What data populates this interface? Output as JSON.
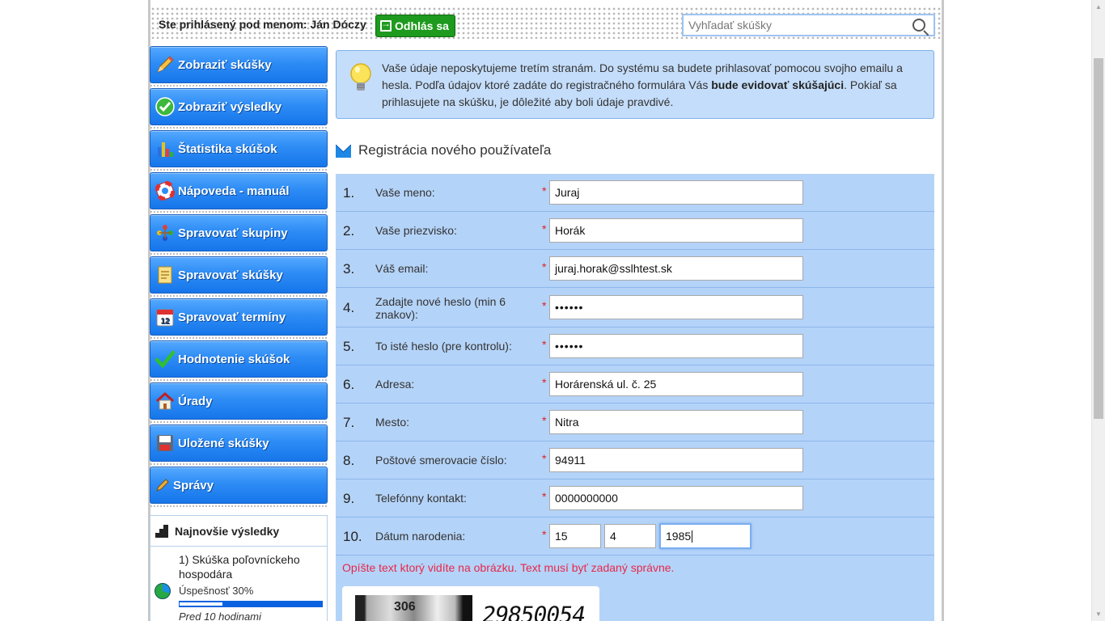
{
  "header": {
    "login_text": "Ste prihlásený pod menom: Ján Dóczy",
    "logout_label": "Odhlás sa",
    "search_placeholder": "Vyhľadať skúšky"
  },
  "sidebar": {
    "items": [
      {
        "label": "Zobraziť skúšky",
        "icon": "pencil-icon"
      },
      {
        "label": "Zobraziť výsledky",
        "icon": "check-circle-icon"
      },
      {
        "label": "Štatistika skúšok",
        "icon": "bar-chart-icon"
      },
      {
        "label": "Nápoveda - manuál",
        "icon": "lifebuoy-icon"
      },
      {
        "label": "Spravovať skupiny",
        "icon": "groups-icon"
      },
      {
        "label": "Spravovať skúšky",
        "icon": "notepad-icon"
      },
      {
        "label": "Spravovať termíny",
        "icon": "calendar-icon"
      },
      {
        "label": "Hodnotenie skúšok",
        "icon": "checkmark-icon"
      },
      {
        "label": "Úrady",
        "icon": "house-icon"
      },
      {
        "label": "Uložené skúšky",
        "icon": "floppy-disk-icon"
      },
      {
        "label": "Správy",
        "icon": "pen-icon"
      }
    ],
    "calendar_day": "12"
  },
  "latest": {
    "title": "Najnovšie výsledky",
    "item_title": "1) Skúška poľovníckeho hospodára",
    "item_rate": "Úspešnosť 30%",
    "item_success": 0.3,
    "item_time": "Pred 10 hodinami"
  },
  "info": {
    "text_before": "Vaše údaje neposkytujeme tretím stranám. Do systému sa budete prihlasovať pomocou svojho emailu a hesla. Podľa údajov ktoré zadáte do registračného formulára Vás ",
    "text_bold": "bude evidovať skúšajúci",
    "text_after": ". Pokiaľ sa prihlasujete na skúšku, je dôležité aby boli údaje pravdivé."
  },
  "form": {
    "title": "Registrácia nového používateľa",
    "rows": [
      {
        "num": "1.",
        "label": "Vaše meno:",
        "value": "Juraj"
      },
      {
        "num": "2.",
        "label": "Vaše priezvisko:",
        "value": "Horák"
      },
      {
        "num": "3.",
        "label": "Váš email:",
        "value": "juraj.horak@sslhtest.sk"
      },
      {
        "num": "4.",
        "label": "Zadajte nové heslo (min 6 znakov):",
        "value": "••••••"
      },
      {
        "num": "5.",
        "label": "To isté heslo (pre kontrolu):",
        "value": "••••••"
      },
      {
        "num": "6.",
        "label": "Adresa:",
        "value": "Horárenská ul. č. 25"
      },
      {
        "num": "7.",
        "label": "Mesto:",
        "value": "Nitra"
      },
      {
        "num": "8.",
        "label": "Poštové smerovacie číslo:",
        "value": "94911"
      },
      {
        "num": "9.",
        "label": "Telefónny kontakt:",
        "value": "0000000000"
      },
      {
        "num": "10.",
        "label": "Dátum narodenia:",
        "day": "15",
        "month": "4",
        "year": "1985"
      }
    ],
    "required_mark": "*",
    "captcha_note": "Opíšte text ktorý vidíte na obrázku. Text musí byť zadaný správne.",
    "captcha_img_text": "306",
    "captcha_text": "29850054"
  }
}
